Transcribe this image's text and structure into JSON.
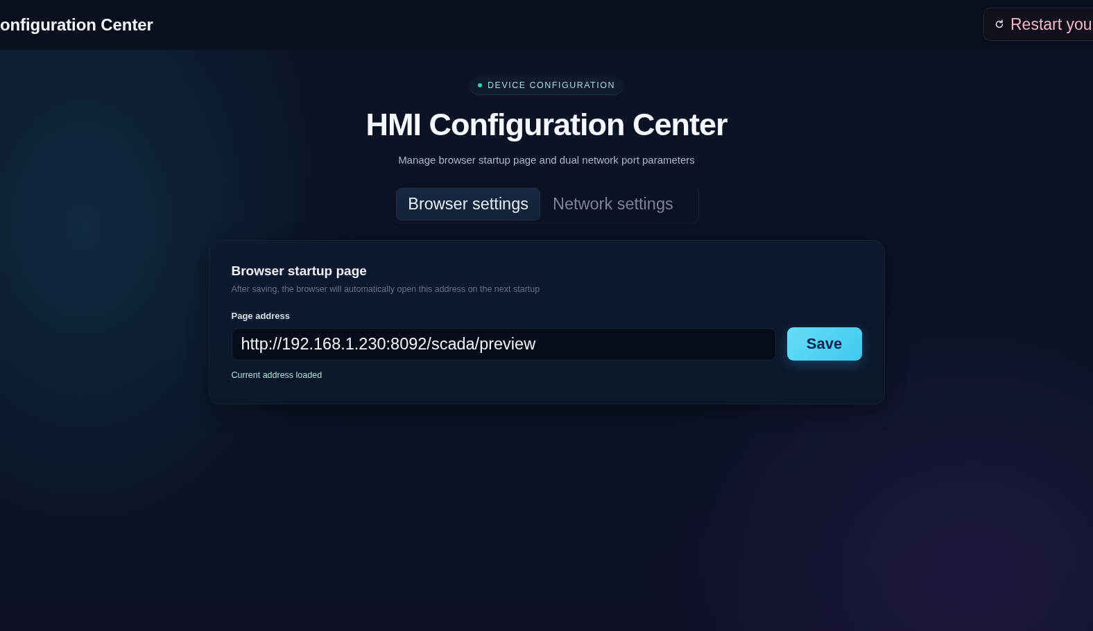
{
  "header": {
    "title": "onfiguration Center",
    "restart_button": {
      "label": "Restart you"
    }
  },
  "hero": {
    "badge": "DEVICE CONFIGURATION",
    "title": "HMI Configuration Center",
    "subtitle": "Manage browser startup page and dual network port parameters"
  },
  "tabs": [
    {
      "label": "Browser settings",
      "selected": true
    },
    {
      "label": "Network settings",
      "selected": false
    }
  ],
  "card": {
    "title": "Browser startup page",
    "description": "After saving, the browser will automatically open this address on the next startup",
    "field": {
      "label": "Page address",
      "value": "http://192.168.1.230:8092/scada/preview"
    },
    "save_button": {
      "label": "Save"
    },
    "status": "Current address loaded"
  }
}
